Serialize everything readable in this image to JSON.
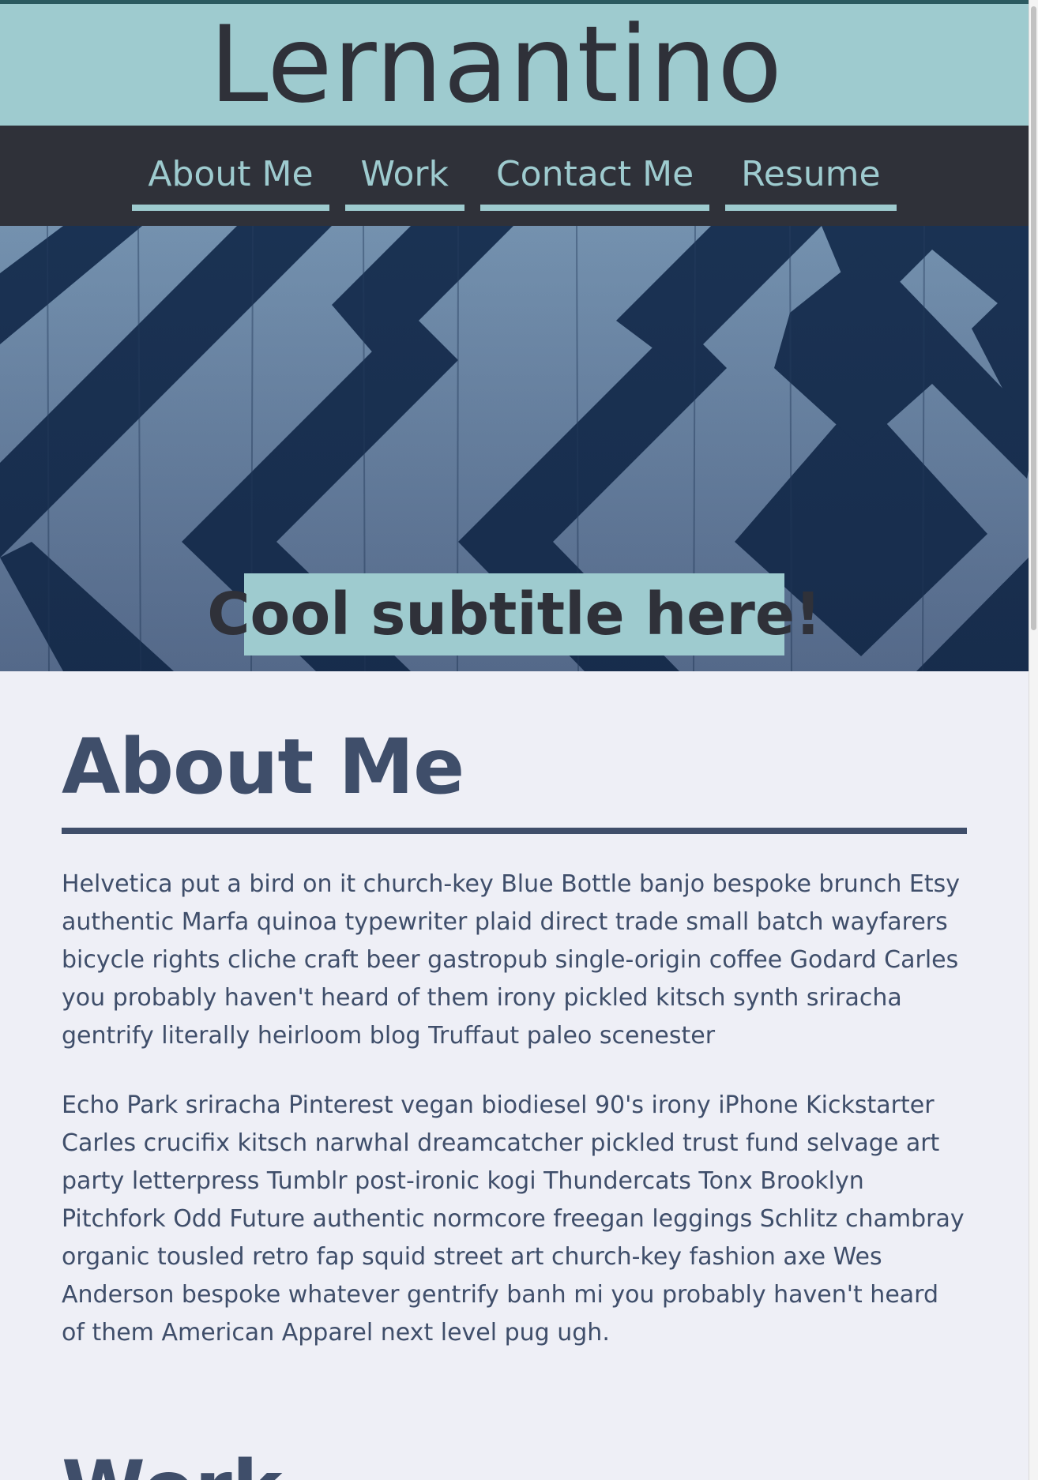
{
  "header": {
    "title": "Lernantino"
  },
  "nav": {
    "items": [
      {
        "label": "About Me"
      },
      {
        "label": "Work"
      },
      {
        "label": "Contact Me"
      },
      {
        "label": "Resume"
      }
    ]
  },
  "hero": {
    "subtitle": "Cool subtitle here!"
  },
  "about": {
    "heading": "About Me",
    "paragraphs": [
      "Helvetica put a bird on it church-key Blue Bottle banjo bespoke brunch Etsy authentic Marfa quinoa typewriter plaid direct trade small batch wayfarers bicycle rights cliche craft beer gastropub single-origin coffee Godard Carles you probably haven't heard of them irony pickled kitsch synth sriracha gentrify literally heirloom blog Truffaut paleo scenester",
      "Echo Park sriracha Pinterest vegan biodiesel 90's irony iPhone Kickstarter Carles crucifix kitsch narwhal dreamcatcher pickled trust fund selvage art party letterpress Tumblr post-ironic kogi Thundercats Tonx Brooklyn Pitchfork Odd Future authentic normcore freegan leggings Schlitz chambray organic tousled retro fap squid street art church-key fashion axe Wes Anderson bespoke whatever gentrify banh mi you probably haven't heard of them American Apparel next level pug ugh."
    ]
  },
  "work": {
    "heading": "Work"
  },
  "colors": {
    "header_bg": "#9ecbcf",
    "nav_bg": "#2f3139",
    "accent_text": "#3f4e6a",
    "page_bg": "#eeeff6"
  }
}
